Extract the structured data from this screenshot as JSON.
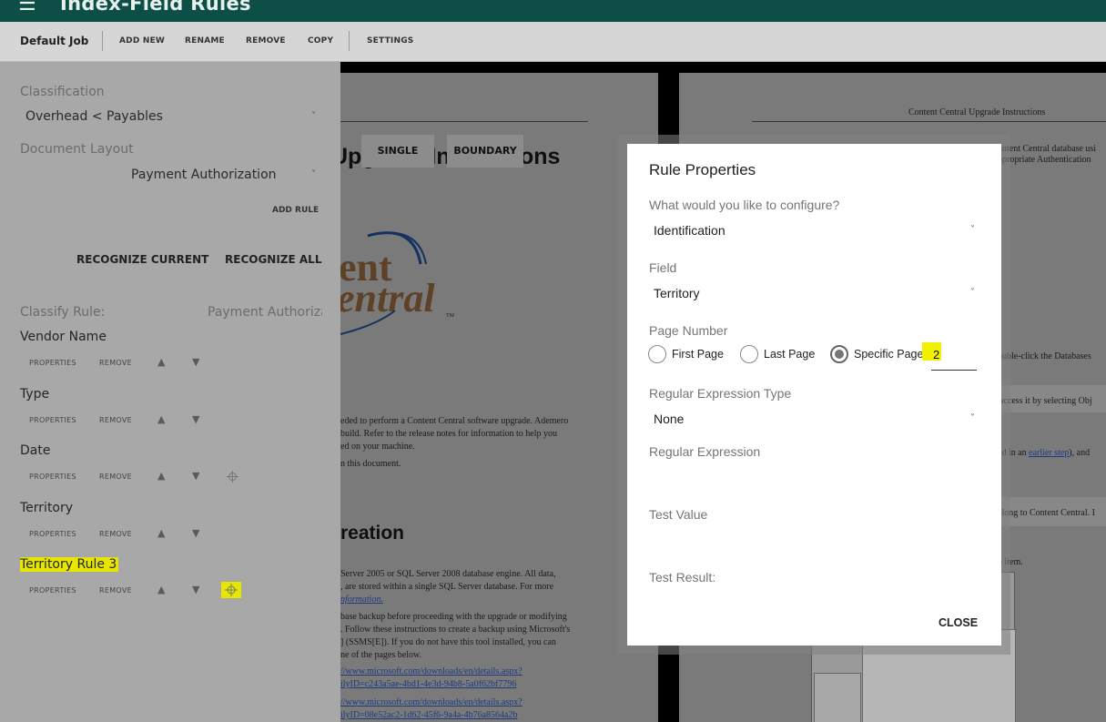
{
  "app": {
    "title": "Index-Field Rules"
  },
  "toolbar": {
    "job": "Default Job",
    "add_new": "ADD NEW",
    "rename": "RENAME",
    "remove": "REMOVE",
    "copy": "COPY",
    "settings": "SETTINGS"
  },
  "left": {
    "classification_label": "Classification",
    "classification_value": "Overhead < Payables",
    "layout_label": "Document Layout",
    "layout_value": "Payment Authorization",
    "add_rule": "ADD RULE",
    "recognize_current": "RECOGNIZE CURRENT",
    "recognize_all": "RECOGNIZE ALL",
    "classify_rule_label": "Classify Rule:",
    "classify_rule_value": "Payment Authorizat",
    "properties": "PROPERTIES",
    "remove": "REMOVE",
    "rules": [
      {
        "name": "Vendor Name"
      },
      {
        "name": "Type"
      },
      {
        "name": "Date"
      },
      {
        "name": "Territory"
      },
      {
        "name": "Territory Rule 3"
      }
    ]
  },
  "document": {
    "overlay_single": "SINGLE",
    "overlay_boundary": "BOUNDARY",
    "header_right": "Content Central Upgrade Instructions",
    "heading_upgrade": "Upgrade Instructions",
    "logo_line1": "ent",
    "logo_line2": "entral",
    "tm": "TM",
    "para1_l1": "eded to perform a Content Central software upgrade. Ademero",
    "para1_l2": "build. Refer to the release notes for information to help you",
    "para1_l3": "ed on your machine.",
    "para2": "n this document.",
    "heading_creation": "reation",
    "para3_l1": "Server 2005 or SQL Server 2008 database engine. All data,",
    "para3_l2": ", are stored within a single SQL Server database. For more",
    "para3_l3": "nformation.",
    "para4_l1": "base backup before proceeding with the upgrade or modifying",
    "para4_l2": ". Follow these instructions to create a backup using Microsoft's",
    "para4_l3": "] (SSMS[E]). If you do not have this tool installed, you can",
    "para4_l4": "ne of the pages below.",
    "link1_l1": "//www.microsoft.com/downloads/en/details.aspx?",
    "link1_l2": "ilyID=c243a5ae-4bd1-4e3d-94b8-5a0f62bf7796",
    "link2_l1": "//www.microsoft.com/downloads/en/details.aspx?",
    "link2_l2": "ilyID=08e52ac2-1d62-45f6-9a4a-4b76a8564a2b",
    "right_t1_l1": "ontent Central database usi",
    "right_t1_l2": "ppropriate Authentication",
    "right_t2": "ouble-click the Databases",
    "right_t3": "access it by selecting Obj",
    "right_t4_pre": "ed in an ",
    "right_t4_link": "earlier step",
    "right_t4_post": "), and",
    "right_t5": "elong to Content Central. I",
    "right_t6": "p item."
  },
  "dialog": {
    "title": "Rule Properties",
    "configure_label": "What would you like to configure?",
    "configure_value": "Identification",
    "field_label": "Field",
    "field_value": "Territory",
    "page_number_label": "Page Number",
    "first_page": "First Page",
    "last_page": "Last Page",
    "specific_page": "Specific Page",
    "specific_page_value": "2",
    "regex_type_label": "Regular Expression Type",
    "regex_type_value": "None",
    "regex_label": "Regular Expression",
    "test_value_label": "Test Value",
    "test_result_label": "Test Result:",
    "close": "CLOSE"
  },
  "icons": {
    "menu": "menu-icon",
    "chevron": "chevron-down-icon",
    "up": "arrow-up-icon",
    "down": "arrow-down-icon",
    "target": "crosshair-target-icon"
  },
  "colors": {
    "header": "#0d4f47",
    "highlight": "#e6e600"
  }
}
